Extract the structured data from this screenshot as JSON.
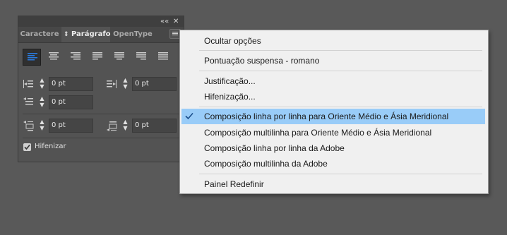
{
  "panel": {
    "collapse_glyph": "««",
    "close_glyph": "✕",
    "tabs": [
      {
        "label": "Caractere",
        "active": false
      },
      {
        "label": "Parágrafo",
        "active": true,
        "icon": "updown-arrows-icon"
      },
      {
        "label": "OpenType",
        "active": false
      }
    ],
    "alignment_buttons": [
      {
        "name": "align-left",
        "active": true
      },
      {
        "name": "align-center",
        "active": false
      },
      {
        "name": "align-right",
        "active": false
      },
      {
        "name": "justify-last-left",
        "active": false
      },
      {
        "name": "justify-last-center",
        "active": false
      },
      {
        "name": "justify-last-right",
        "active": false
      },
      {
        "name": "justify-all",
        "active": false
      }
    ],
    "fields": {
      "left_indent": "0 pt",
      "right_indent": "0 pt",
      "first_line_indent": "0 pt",
      "space_before": "0 pt",
      "space_after": "0 pt"
    },
    "hyphenate": {
      "label": "Hifenizar",
      "checked": true
    }
  },
  "menu": {
    "items": [
      {
        "label": "Ocultar opções",
        "checked": false,
        "selected": false
      },
      {
        "label": "Pontuação suspensa - romano",
        "checked": false,
        "selected": false
      },
      {
        "label": "Justificação...",
        "checked": false,
        "selected": false
      },
      {
        "label": "Hifenização...",
        "checked": false,
        "selected": false
      },
      {
        "label": "Composição linha por linha para Oriente Médio e Ásia Meridional",
        "checked": true,
        "selected": true
      },
      {
        "label": "Composição multilinha para Oriente Médio e Ásia Meridional",
        "checked": false,
        "selected": false
      },
      {
        "label": "Composição linha por linha da Adobe",
        "checked": false,
        "selected": false
      },
      {
        "label": "Composição multilinha da Adobe",
        "checked": false,
        "selected": false
      },
      {
        "label": "Painel Redefinir",
        "checked": false,
        "selected": false
      }
    ]
  },
  "colors": {
    "background": "#595959",
    "panel": "#535353",
    "menu_bg": "#f0f0f0",
    "menu_highlight": "#99ccf8",
    "active_align_icon": "#2a7be0"
  }
}
